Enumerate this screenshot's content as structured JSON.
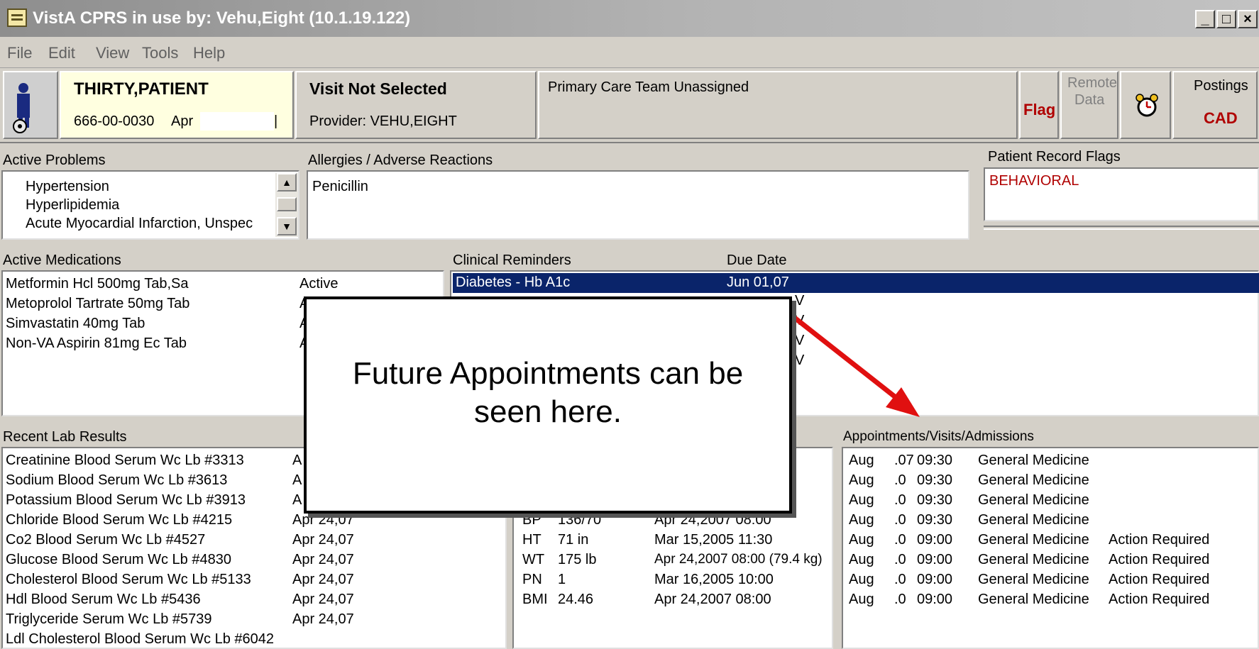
{
  "window": {
    "title": "VistA CPRS in use by: Vehu,Eight  (10.1.19.122)",
    "controls": [
      "_",
      "□",
      "×"
    ]
  },
  "menu": [
    "File",
    "Edit",
    "View",
    "Tools",
    "Help"
  ],
  "patient": {
    "name": "THIRTY,PATIENT",
    "ssn": "666-00-0030",
    "dob": "Apr"
  },
  "visit": {
    "title": "Visit Not Selected",
    "provider": "Provider:  VEHU,EIGHT"
  },
  "team": "Primary Care Team Unassigned",
  "header_buttons": {
    "flag": "Flag",
    "remote_line1": "Remote",
    "remote_line2": "Data",
    "postings": "Postings",
    "cad": "CAD"
  },
  "problems": {
    "label": "Active Problems",
    "items": [
      "Hypertension",
      "Hyperlipidemia",
      "Acute Myocardial Infarction, Unspec"
    ]
  },
  "allergies": {
    "label": "Allergies / Adverse Reactions",
    "items": [
      "Penicillin"
    ]
  },
  "record_flags": {
    "label": "Patient Record Flags",
    "items": [
      "BEHAVIORAL"
    ]
  },
  "medications": {
    "label": "Active Medications",
    "items": [
      {
        "name": "Metformin Hcl 500mg Tab,Sa",
        "status": "Active"
      },
      {
        "name": "Metoprolol Tartrate 50mg Tab",
        "status": "A"
      },
      {
        "name": "Simvastatin 40mg Tab",
        "status": "A"
      },
      {
        "name": "Non-VA  Aspirin 81mg Ec Tab",
        "status": "A"
      }
    ]
  },
  "reminders": {
    "label": "Clinical Reminders",
    "due_label": "Due Date",
    "items": [
      {
        "name": "Diabetes - Hb A1c",
        "due": "Jun 01,07"
      },
      {
        "name": "",
        "due": "V"
      },
      {
        "name": "",
        "due": "V"
      },
      {
        "name": "",
        "due": "V"
      },
      {
        "name": "",
        "due": "V"
      }
    ]
  },
  "labs": {
    "label": "Recent Lab Results",
    "items": [
      {
        "name": "Creatinine Blood   Serum Wc Lb #3313",
        "date": "A"
      },
      {
        "name": "Sodium Blood   Serum Wc Lb #3613",
        "date": "A"
      },
      {
        "name": "Potassium Blood   Serum Wc Lb #3913",
        "date": "A"
      },
      {
        "name": "Chloride Blood   Serum Wc Lb #4215",
        "date": "Apr 24,07"
      },
      {
        "name": "Co2 Blood   Serum Wc Lb #4527",
        "date": "Apr 24,07"
      },
      {
        "name": "Glucose Blood   Serum Wc Lb #4830",
        "date": "Apr 24,07"
      },
      {
        "name": "Cholesterol Blood   Serum Wc Lb #5133",
        "date": "Apr 24,07"
      },
      {
        "name": "Hdl Blood   Serum Wc Lb #5436",
        "date": "Apr 24,07"
      },
      {
        "name": "Triglyceride Serum Wc Lb #5739",
        "date": "Apr 24,07"
      },
      {
        "name": "Ldl Cholesterol Blood   Serum Wc Lb #6042",
        "date": ""
      }
    ]
  },
  "vitals": {
    "items": [
      {
        "code": "BP",
        "value": "136/70",
        "date": "Apr 24,2007 08:00"
      },
      {
        "code": "HT",
        "value": "71 in",
        "date": "Mar 15,2005 11:30"
      },
      {
        "code": "WT",
        "value": "175 lb",
        "date": "Apr 24,2007 08:00 (79.4 kg)"
      },
      {
        "code": "PN",
        "value": "1",
        "date": "Mar 16,2005 10:00"
      },
      {
        "code": "BMI",
        "value": "24.46",
        "date": "Apr 24,2007 08:00"
      }
    ]
  },
  "appointments": {
    "label": "Appointments/Visits/Admissions",
    "items": [
      {
        "month": "Aug",
        "day": ".07",
        "time": "09:30",
        "clinic": "General Medicine",
        "status": ""
      },
      {
        "month": "Aug",
        "day": ".0",
        "time": "09:30",
        "clinic": "General Medicine",
        "status": ""
      },
      {
        "month": "Aug",
        "day": ".0",
        "time": "09:30",
        "clinic": "General Medicine",
        "status": ""
      },
      {
        "month": "Aug",
        "day": ".0",
        "time": "09:30",
        "clinic": "General Medicine",
        "status": ""
      },
      {
        "month": "Aug",
        "day": ".0",
        "time": "09:00",
        "clinic": "General Medicine",
        "status": "Action Required"
      },
      {
        "month": "Aug",
        "day": ".0",
        "time": "09:00",
        "clinic": "General Medicine",
        "status": "Action Required"
      },
      {
        "month": "Aug",
        "day": ".0",
        "time": "09:00",
        "clinic": "General Medicine",
        "status": "Action Required"
      },
      {
        "month": "Aug",
        "day": ".0",
        "time": "09:00",
        "clinic": "General Medicine",
        "status": "Action Required"
      }
    ]
  },
  "callout": {
    "line1": "Future Appointments can be",
    "line2": "seen here."
  },
  "colors": {
    "selection": "#0a246a",
    "flag_red": "#b00000",
    "arrow": "#e01010"
  }
}
